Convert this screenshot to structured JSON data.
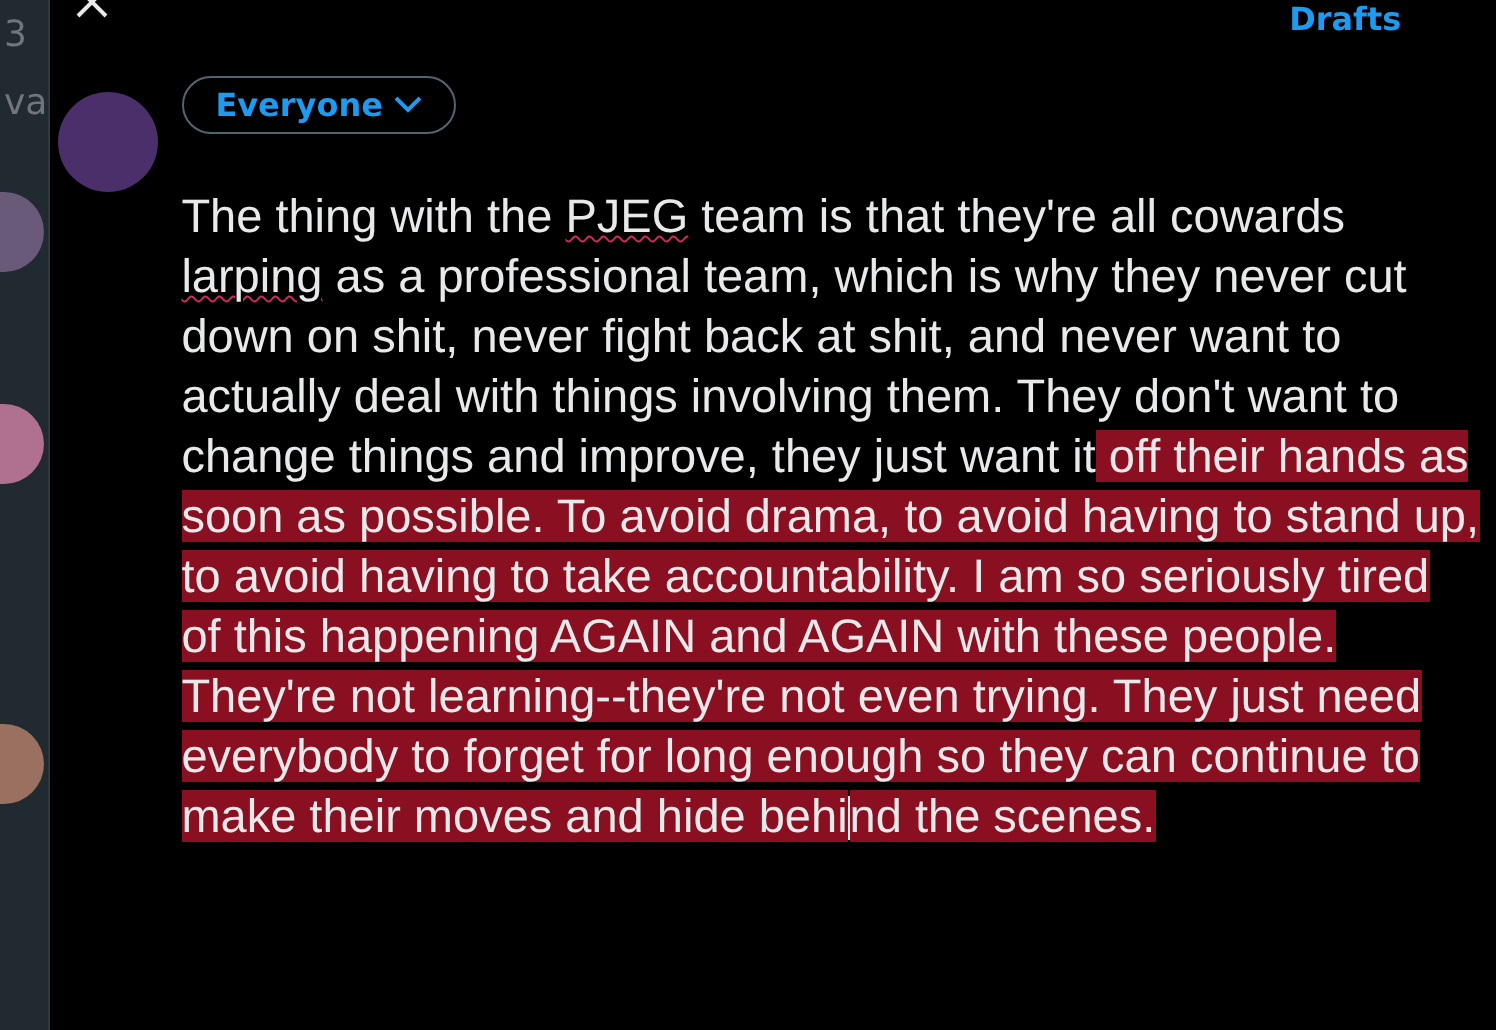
{
  "sidebar": {
    "fragments": [
      "3",
      "va"
    ]
  },
  "header": {
    "drafts_link": "Drafts"
  },
  "composer": {
    "audience": "Everyone",
    "segments": [
      {
        "kind": "plain",
        "text": "The thing with the "
      },
      {
        "kind": "misspelled",
        "text": "PJEG"
      },
      {
        "kind": "plain",
        "text": " team is that they're all cowards "
      },
      {
        "kind": "misspelled",
        "text": "larping"
      },
      {
        "kind": "plain",
        "text": " as a professional team, which is why they never cut down on shit, never fight back at shit, and never want to actually deal with things involving them. They don't want to change things and improve, they just want it"
      },
      {
        "kind": "selected",
        "text": " off their hands as soon as possible. To avoid drama, to avoid having to stand up, to avoid having to take accountability. I am so seriously tired of this happening AGAIN and AGAIN with these people. They're not learning--they're not even trying. They just need everybody to forget for long enough so they can continue to make their moves and hide behi"
      },
      {
        "kind": "caret"
      },
      {
        "kind": "selected",
        "text": "nd the scenes."
      }
    ]
  }
}
